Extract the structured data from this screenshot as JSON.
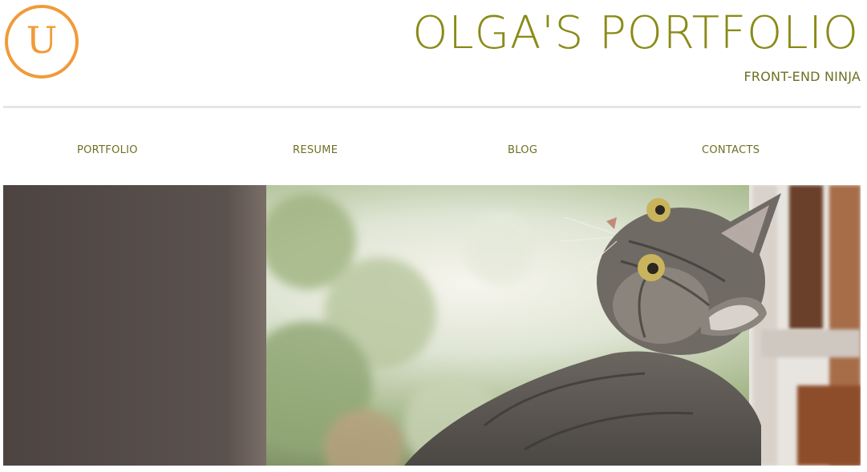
{
  "header": {
    "logo_letter": "U",
    "title": "OLGA'S PORTFOLIO",
    "subtitle": "FRONT-END NINJA"
  },
  "nav": {
    "items": [
      {
        "label": "PORTFOLIO"
      },
      {
        "label": "RESUME"
      },
      {
        "label": "BLOG"
      },
      {
        "label": "CONTACTS"
      }
    ]
  },
  "colors": {
    "accent_orange": "#f29a38",
    "title_olive": "#8a8a18",
    "nav_text": "#6f6f24",
    "divider": "#e5e5e5"
  },
  "hero": {
    "icon": "cat-photo"
  }
}
